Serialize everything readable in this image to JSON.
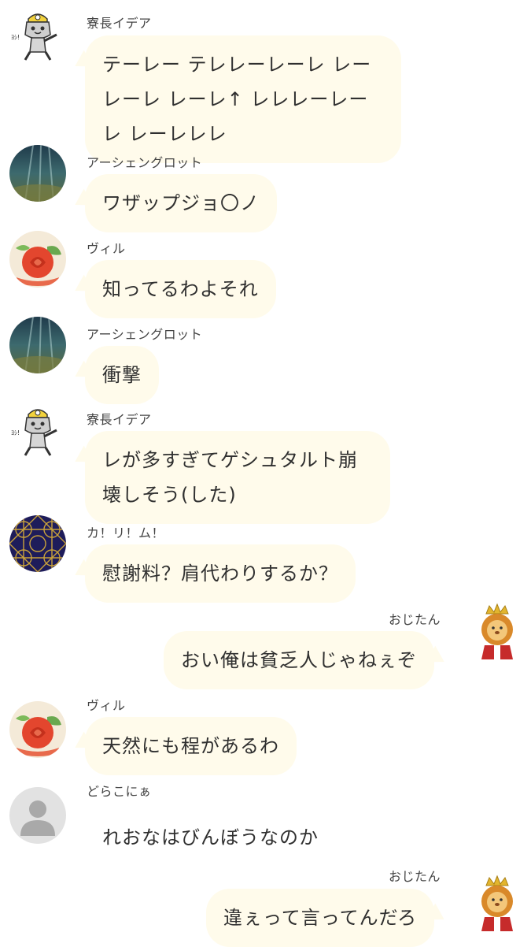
{
  "colors": {
    "bubble": "#fffbeb",
    "text": "#2f2f2f",
    "sender": "#444444"
  },
  "messages": [
    {
      "sender": "寮長イデア",
      "text": "テーレー テレレーレーレ レーレーレ レーレ↑ レレレーレーレ レーレレレ",
      "avatar": "cat-hardhat-icon",
      "side": "left"
    },
    {
      "sender": "アーシェングロット",
      "text": "ワザップジョ〇ノ",
      "avatar": "underwater-scene-icon",
      "side": "left"
    },
    {
      "sender": "ヴィル",
      "text": "知ってるわよそれ",
      "avatar": "tomato-rose-icon",
      "side": "left"
    },
    {
      "sender": "アーシェングロット",
      "text": "衝撃",
      "avatar": "underwater-scene-icon",
      "side": "left"
    },
    {
      "sender": "寮長イデア",
      "text": "レが多すぎてゲシュタルト崩壊しそう(した)",
      "avatar": "cat-hardhat-icon",
      "side": "left"
    },
    {
      "sender": "カ！リ！ム！",
      "text": "慰謝料？肩代わりするか？",
      "avatar": "geometric-pattern-icon",
      "side": "left"
    },
    {
      "sender": "おじたん",
      "text": "おい俺は貧乏人じゃねぇぞ",
      "avatar": "lion-king-icon",
      "side": "right"
    },
    {
      "sender": "ヴィル",
      "text": "天然にも程があるわ",
      "avatar": "tomato-rose-icon",
      "side": "left"
    },
    {
      "sender": "どらこにぁ",
      "text": "れおなはびんぼうなのか",
      "avatar": "default-user-icon",
      "side": "left"
    },
    {
      "sender": "おじたん",
      "text": "違ぇって言ってんだろ",
      "avatar": "lion-king-icon",
      "side": "right"
    }
  ]
}
